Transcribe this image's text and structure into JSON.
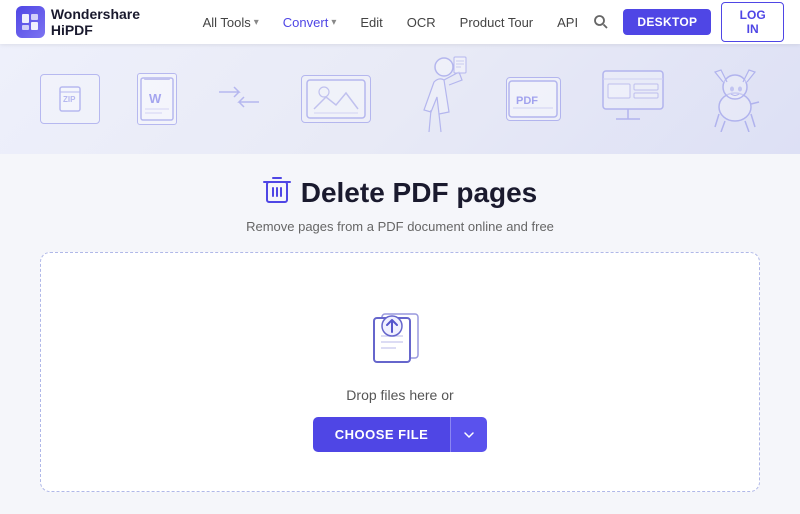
{
  "navbar": {
    "logo_text": "Wondershare HiPDF",
    "links": [
      {
        "label": "All Tools",
        "has_chevron": true
      },
      {
        "label": "Convert",
        "has_chevron": true
      },
      {
        "label": "Edit",
        "has_chevron": false
      },
      {
        "label": "OCR",
        "has_chevron": false
      },
      {
        "label": "Product Tour",
        "has_chevron": false
      },
      {
        "label": "API",
        "has_chevron": false
      }
    ],
    "desktop_btn": "DESKTOP",
    "login_btn": "LOG IN"
  },
  "main": {
    "page_title": "Delete PDF pages",
    "page_subtitle": "Remove pages from a PDF document online and free",
    "drop_label": "Drop files here or",
    "choose_file_btn": "CHOOSE FILE"
  }
}
